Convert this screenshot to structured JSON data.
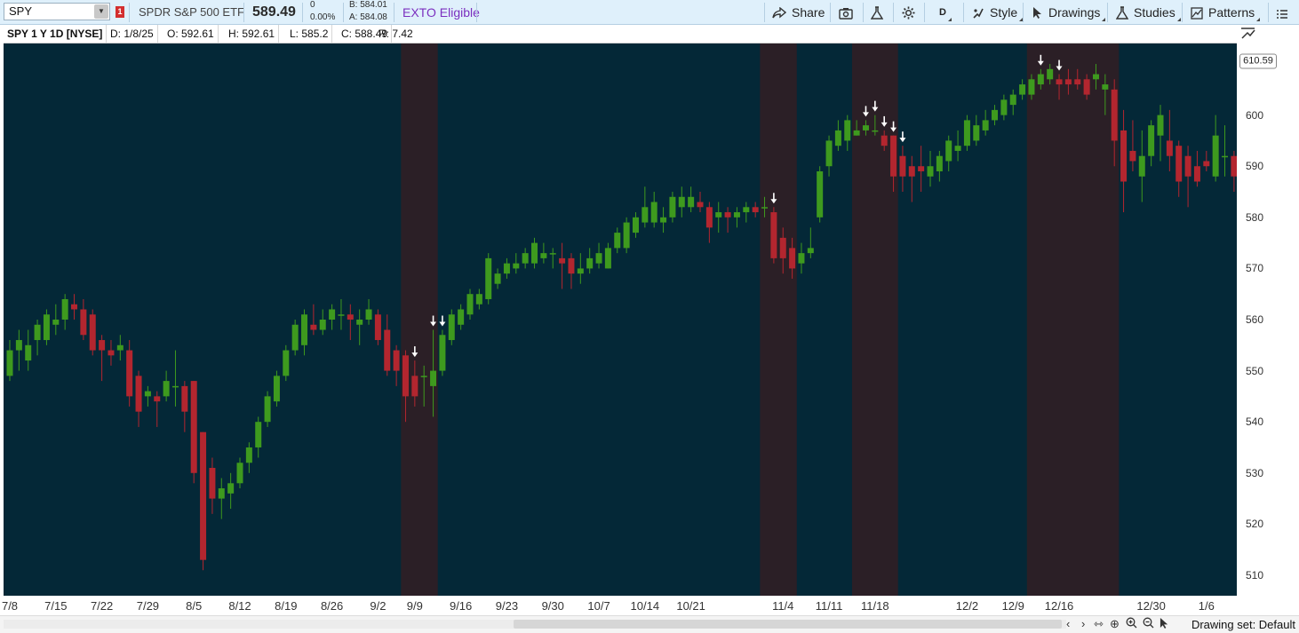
{
  "toolbar": {
    "symbol": "SPY",
    "alert_count": "1",
    "description": "SPDR S&P 500 ETF",
    "last_price": "589.49",
    "net_change": "0",
    "pct_change": "0.00%",
    "bid": "B: 584.01",
    "ask": "A: 584.08",
    "exto": "EXTO Eligible",
    "share_label": "Share",
    "timeframe_label": "D",
    "style_label": "Style",
    "drawings_label": "Drawings",
    "studies_label": "Studies",
    "patterns_label": "Patterns"
  },
  "infobar": {
    "title": "SPY 1 Y 1D [NYSE]",
    "date": "D: 1/8/25",
    "open": "O: 592.61",
    "high": "H: 592.61",
    "low": "L: 585.2",
    "close": "C: 588.49",
    "range": "R: 7.42"
  },
  "colors": {
    "background": "#042837",
    "up": "#3e9a1e",
    "down": "#b3262f",
    "highlight_band": "#2b1f26",
    "arrow": "#ffffff"
  },
  "chart_data": {
    "type": "candlestick",
    "title": "SPY 1 Y 1D [NYSE]",
    "ylim": [
      506,
      614
    ],
    "y_ticks": [
      510,
      520,
      530,
      540,
      550,
      560,
      570,
      580,
      590,
      600,
      610
    ],
    "last_price_tag": "610.59",
    "x_tick_labels": [
      {
        "label": "7/8",
        "index": 0
      },
      {
        "label": "7/15",
        "index": 5
      },
      {
        "label": "7/22",
        "index": 10
      },
      {
        "label": "7/29",
        "index": 15
      },
      {
        "label": "8/5",
        "index": 20
      },
      {
        "label": "8/12",
        "index": 25
      },
      {
        "label": "8/19",
        "index": 30
      },
      {
        "label": "8/26",
        "index": 35
      },
      {
        "label": "9/2",
        "index": 40
      },
      {
        "label": "9/9",
        "index": 44
      },
      {
        "label": "9/16",
        "index": 49
      },
      {
        "label": "9/23",
        "index": 54
      },
      {
        "label": "9/30",
        "index": 59
      },
      {
        "label": "10/7",
        "index": 64
      },
      {
        "label": "10/14",
        "index": 69
      },
      {
        "label": "10/21",
        "index": 74
      },
      {
        "label": "11/4",
        "index": 84
      },
      {
        "label": "11/11",
        "index": 89
      },
      {
        "label": "11/18",
        "index": 94
      },
      {
        "label": "12/2",
        "index": 104
      },
      {
        "label": "12/9",
        "index": 109
      },
      {
        "label": "12/16",
        "index": 114
      },
      {
        "label": "12/30",
        "index": 124
      },
      {
        "label": "1/6",
        "index": 130
      }
    ],
    "candles": [
      {
        "o": 549,
        "h": 556,
        "l": 548,
        "c": 554
      },
      {
        "o": 554,
        "h": 558,
        "l": 550,
        "c": 556
      },
      {
        "o": 552,
        "h": 558,
        "l": 550,
        "c": 555
      },
      {
        "o": 556,
        "h": 560,
        "l": 553,
        "c": 559
      },
      {
        "o": 556,
        "h": 562,
        "l": 555,
        "c": 561
      },
      {
        "o": 559,
        "h": 563,
        "l": 557,
        "c": 560
      },
      {
        "o": 560,
        "h": 565,
        "l": 558,
        "c": 564
      },
      {
        "o": 563,
        "h": 565,
        "l": 560,
        "c": 562
      },
      {
        "o": 562,
        "h": 564,
        "l": 556,
        "c": 557
      },
      {
        "o": 561,
        "h": 562,
        "l": 553,
        "c": 554
      },
      {
        "o": 556,
        "h": 557,
        "l": 548,
        "c": 554
      },
      {
        "o": 554,
        "h": 556,
        "l": 551,
        "c": 553
      },
      {
        "o": 554,
        "h": 557,
        "l": 552,
        "c": 555
      },
      {
        "o": 554,
        "h": 556,
        "l": 543,
        "c": 545
      },
      {
        "o": 549,
        "h": 550,
        "l": 539,
        "c": 542
      },
      {
        "o": 545,
        "h": 547,
        "l": 543,
        "c": 546
      },
      {
        "o": 545,
        "h": 546,
        "l": 539,
        "c": 544
      },
      {
        "o": 545,
        "h": 550,
        "l": 544,
        "c": 548
      },
      {
        "o": 547,
        "h": 554,
        "l": 543,
        "c": 547
      },
      {
        "o": 547,
        "h": 548,
        "l": 538,
        "c": 542
      },
      {
        "o": 548,
        "h": 548,
        "l": 528,
        "c": 530
      },
      {
        "o": 538,
        "h": 538,
        "l": 511,
        "c": 513
      },
      {
        "o": 531,
        "h": 533,
        "l": 522,
        "c": 525
      },
      {
        "o": 525,
        "h": 529,
        "l": 521,
        "c": 527
      },
      {
        "o": 526,
        "h": 530,
        "l": 523,
        "c": 528
      },
      {
        "o": 528,
        "h": 533,
        "l": 527,
        "c": 532
      },
      {
        "o": 532,
        "h": 536,
        "l": 530,
        "c": 535
      },
      {
        "o": 535,
        "h": 541,
        "l": 533,
        "c": 540
      },
      {
        "o": 540,
        "h": 546,
        "l": 539,
        "c": 545
      },
      {
        "o": 544,
        "h": 550,
        "l": 543,
        "c": 549
      },
      {
        "o": 549,
        "h": 555,
        "l": 548,
        "c": 554
      },
      {
        "o": 554,
        "h": 560,
        "l": 553,
        "c": 559
      },
      {
        "o": 555,
        "h": 562,
        "l": 553,
        "c": 561
      },
      {
        "o": 559,
        "h": 563,
        "l": 557,
        "c": 558
      },
      {
        "o": 558,
        "h": 562,
        "l": 557,
        "c": 560
      },
      {
        "o": 560,
        "h": 563,
        "l": 558,
        "c": 562
      },
      {
        "o": 561,
        "h": 564,
        "l": 558,
        "c": 561
      },
      {
        "o": 561,
        "h": 563,
        "l": 556,
        "c": 560
      },
      {
        "o": 559,
        "h": 562,
        "l": 555,
        "c": 560
      },
      {
        "o": 560,
        "h": 564,
        "l": 559,
        "c": 562
      },
      {
        "o": 561,
        "h": 562,
        "l": 555,
        "c": 556
      },
      {
        "o": 558,
        "h": 561,
        "l": 549,
        "c": 550
      },
      {
        "o": 554,
        "h": 555,
        "l": 547,
        "c": 550
      },
      {
        "o": 553,
        "h": 554,
        "l": 540,
        "c": 545
      },
      {
        "o": 549,
        "h": 552,
        "l": 543,
        "c": 545
      },
      {
        "o": 549,
        "h": 551,
        "l": 543,
        "c": 549
      },
      {
        "o": 547,
        "h": 558,
        "l": 541,
        "c": 550
      },
      {
        "o": 550,
        "h": 558,
        "l": 549,
        "c": 557
      },
      {
        "o": 556,
        "h": 562,
        "l": 555,
        "c": 561
      },
      {
        "o": 559,
        "h": 563,
        "l": 558,
        "c": 562
      },
      {
        "o": 561,
        "h": 566,
        "l": 560,
        "c": 565
      },
      {
        "o": 563,
        "h": 566,
        "l": 562,
        "c": 565
      },
      {
        "o": 564,
        "h": 573,
        "l": 563,
        "c": 572
      },
      {
        "o": 567,
        "h": 570,
        "l": 566,
        "c": 569
      },
      {
        "o": 569,
        "h": 572,
        "l": 568,
        "c": 571
      },
      {
        "o": 570,
        "h": 573,
        "l": 569,
        "c": 571
      },
      {
        "o": 571,
        "h": 574,
        "l": 570,
        "c": 573
      },
      {
        "o": 571,
        "h": 576,
        "l": 570,
        "c": 575
      },
      {
        "o": 572,
        "h": 575,
        "l": 571,
        "c": 573
      },
      {
        "o": 573,
        "h": 574,
        "l": 570,
        "c": 573
      },
      {
        "o": 572,
        "h": 575,
        "l": 566,
        "c": 571
      },
      {
        "o": 572,
        "h": 573,
        "l": 566,
        "c": 569
      },
      {
        "o": 569,
        "h": 573,
        "l": 567,
        "c": 570
      },
      {
        "o": 570,
        "h": 574,
        "l": 569,
        "c": 572
      },
      {
        "o": 571,
        "h": 575,
        "l": 570,
        "c": 573
      },
      {
        "o": 570,
        "h": 575,
        "l": 570,
        "c": 574
      },
      {
        "o": 574,
        "h": 578,
        "l": 573,
        "c": 577
      },
      {
        "o": 574,
        "h": 580,
        "l": 573,
        "c": 579
      },
      {
        "o": 577,
        "h": 581,
        "l": 576,
        "c": 580
      },
      {
        "o": 579,
        "h": 586,
        "l": 578,
        "c": 582
      },
      {
        "o": 579,
        "h": 585,
        "l": 578,
        "c": 583
      },
      {
        "o": 579,
        "h": 582,
        "l": 577,
        "c": 580
      },
      {
        "o": 580,
        "h": 585,
        "l": 579,
        "c": 584
      },
      {
        "o": 582,
        "h": 586,
        "l": 580,
        "c": 584
      },
      {
        "o": 582,
        "h": 586,
        "l": 581,
        "c": 584
      },
      {
        "o": 583,
        "h": 585,
        "l": 581,
        "c": 582
      },
      {
        "o": 582,
        "h": 583,
        "l": 575,
        "c": 578
      },
      {
        "o": 580,
        "h": 583,
        "l": 577,
        "c": 581
      },
      {
        "o": 581,
        "h": 582,
        "l": 577,
        "c": 580
      },
      {
        "o": 580,
        "h": 582,
        "l": 578,
        "c": 581
      },
      {
        "o": 581,
        "h": 583,
        "l": 579,
        "c": 582
      },
      {
        "o": 582,
        "h": 583,
        "l": 580,
        "c": 581
      },
      {
        "o": 582,
        "h": 584,
        "l": 580,
        "c": 582
      },
      {
        "o": 581,
        "h": 582,
        "l": 571,
        "c": 572
      },
      {
        "o": 576,
        "h": 578,
        "l": 569,
        "c": 572
      },
      {
        "o": 574,
        "h": 576,
        "l": 568,
        "c": 570
      },
      {
        "o": 571,
        "h": 575,
        "l": 569,
        "c": 573
      },
      {
        "o": 573,
        "h": 578,
        "l": 572,
        "c": 574
      },
      {
        "o": 580,
        "h": 590,
        "l": 579,
        "c": 589
      },
      {
        "o": 590,
        "h": 596,
        "l": 588,
        "c": 595
      },
      {
        "o": 594,
        "h": 599,
        "l": 593,
        "c": 597
      },
      {
        "o": 595,
        "h": 600,
        "l": 593,
        "c": 599
      },
      {
        "o": 596,
        "h": 599,
        "l": 596,
        "c": 597
      },
      {
        "o": 597,
        "h": 599,
        "l": 596,
        "c": 598
      },
      {
        "o": 597,
        "h": 600,
        "l": 596,
        "c": 597
      },
      {
        "o": 596,
        "h": 597,
        "l": 593,
        "c": 594
      },
      {
        "o": 596,
        "h": 596,
        "l": 585,
        "c": 588
      },
      {
        "o": 592,
        "h": 594,
        "l": 585,
        "c": 588
      },
      {
        "o": 590,
        "h": 592,
        "l": 583,
        "c": 588
      },
      {
        "o": 590,
        "h": 594,
        "l": 585,
        "c": 589
      },
      {
        "o": 588,
        "h": 593,
        "l": 586,
        "c": 590
      },
      {
        "o": 589,
        "h": 593,
        "l": 587,
        "c": 592
      },
      {
        "o": 591,
        "h": 596,
        "l": 589,
        "c": 595
      },
      {
        "o": 593,
        "h": 597,
        "l": 591,
        "c": 594
      },
      {
        "o": 594,
        "h": 600,
        "l": 593,
        "c": 599
      },
      {
        "o": 595,
        "h": 600,
        "l": 594,
        "c": 598
      },
      {
        "o": 597,
        "h": 601,
        "l": 596,
        "c": 599
      },
      {
        "o": 599,
        "h": 602,
        "l": 598,
        "c": 601
      },
      {
        "o": 600,
        "h": 604,
        "l": 599,
        "c": 603
      },
      {
        "o": 602,
        "h": 605,
        "l": 600,
        "c": 604
      },
      {
        "o": 604,
        "h": 607,
        "l": 603,
        "c": 606
      },
      {
        "o": 604,
        "h": 608,
        "l": 603,
        "c": 607
      },
      {
        "o": 606,
        "h": 609,
        "l": 605,
        "c": 608
      },
      {
        "o": 607,
        "h": 610,
        "l": 606,
        "c": 609
      },
      {
        "o": 607,
        "h": 608,
        "l": 603,
        "c": 606
      },
      {
        "o": 607,
        "h": 609,
        "l": 604,
        "c": 606
      },
      {
        "o": 607,
        "h": 609,
        "l": 605,
        "c": 606
      },
      {
        "o": 607,
        "h": 608,
        "l": 603,
        "c": 604
      },
      {
        "o": 607,
        "h": 610,
        "l": 605,
        "c": 608
      },
      {
        "o": 605,
        "h": 608,
        "l": 600,
        "c": 606
      },
      {
        "o": 605,
        "h": 607,
        "l": 590,
        "c": 595
      },
      {
        "o": 597,
        "h": 601,
        "l": 581,
        "c": 587
      },
      {
        "o": 593,
        "h": 599,
        "l": 589,
        "c": 591
      },
      {
        "o": 588,
        "h": 597,
        "l": 583,
        "c": 592
      },
      {
        "o": 592,
        "h": 599,
        "l": 590,
        "c": 598
      },
      {
        "o": 596,
        "h": 602,
        "l": 591,
        "c": 600
      },
      {
        "o": 595,
        "h": 601,
        "l": 589,
        "c": 592
      },
      {
        "o": 594,
        "h": 595,
        "l": 584,
        "c": 587
      },
      {
        "o": 592,
        "h": 594,
        "l": 582,
        "c": 588
      },
      {
        "o": 590,
        "h": 593,
        "l": 586,
        "c": 587
      },
      {
        "o": 591,
        "h": 593,
        "l": 589,
        "c": 590
      },
      {
        "o": 588,
        "h": 600,
        "l": 587,
        "c": 596
      },
      {
        "o": 592,
        "h": 598,
        "l": 588,
        "c": 592
      },
      {
        "o": 592,
        "h": 593,
        "l": 585,
        "c": 588
      }
    ],
    "highlight_ranges": [
      [
        43,
        46
      ],
      [
        82,
        85
      ],
      [
        92,
        96
      ],
      [
        111,
        120
      ]
    ],
    "arrow_markers": [
      44,
      46,
      47,
      83,
      93,
      94,
      95,
      96,
      97,
      112,
      114
    ]
  },
  "bottombar": {
    "drawing_set": "Drawing set: Default"
  }
}
